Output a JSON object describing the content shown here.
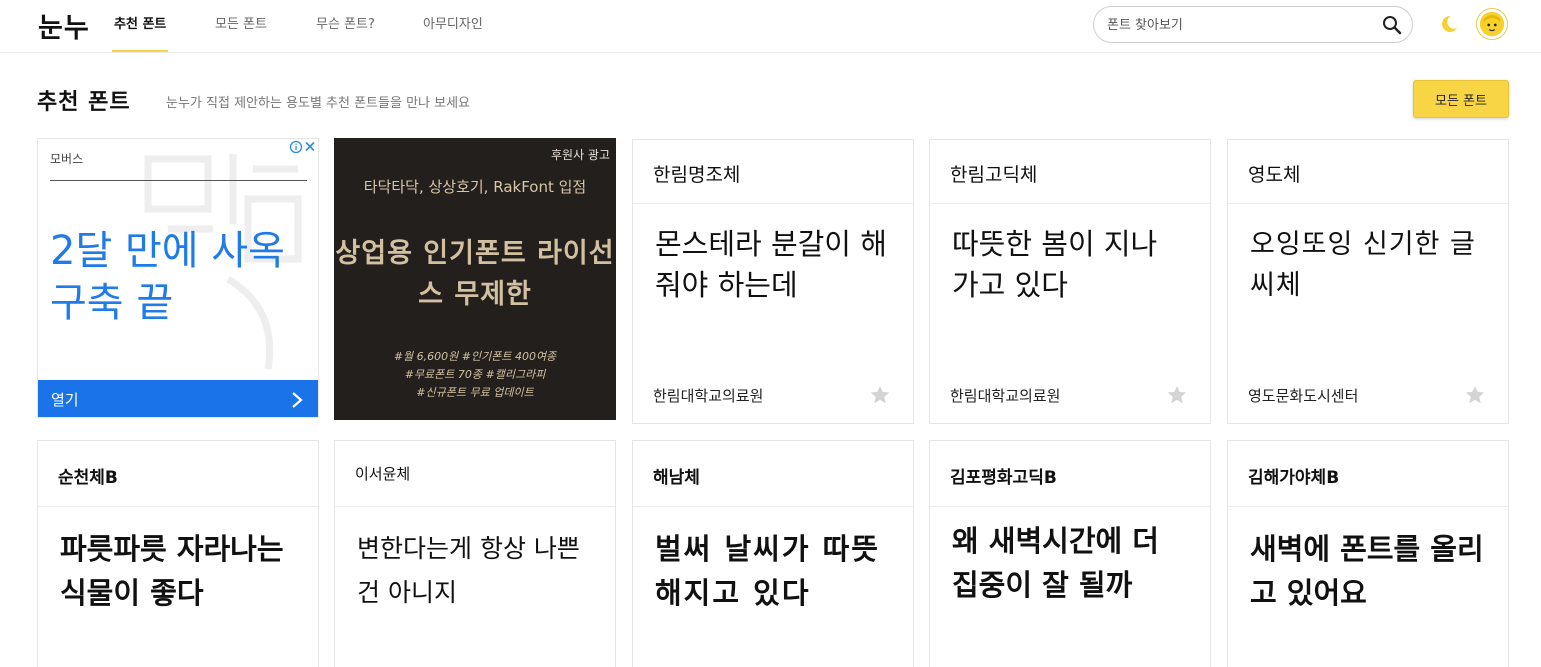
{
  "header": {
    "logo": "눈누",
    "nav": [
      "추천 폰트",
      "모든 폰트",
      "무슨 폰트?",
      "아무디자인"
    ],
    "search_placeholder": "폰트 찾아보기"
  },
  "section": {
    "title": "추천 폰트",
    "subtitle": "눈누가 직접 제안하는 용도별 추천 폰트들을 만나 보세요",
    "all_fonts_button": "모든 폰트"
  },
  "ad_google": {
    "label": "모버스",
    "headline": "2달 만에 사옥 구축 끝",
    "open_label": "열기",
    "accent_color": "#1a73e8"
  },
  "ad_sponsor": {
    "badge": "후원사 광고",
    "top_line": "타닥타닥, 상상호기, RakFont 입점",
    "main": "상업용 인기폰트 라이선스 무제한",
    "tags": [
      "#월 6,600원 #인기폰트 400여종",
      "#무료폰트 70종 #캘리그라피",
      "#신규폰트 무료 업데이트"
    ]
  },
  "fonts_row1": [
    {
      "name": "한림명조체",
      "sample": "몬스테라 분갈이 해줘야 하는데",
      "maker": "한림대학교의료원"
    },
    {
      "name": "한림고딕체",
      "sample": "따뜻한 봄이 지나 가고 있다",
      "maker": "한림대학교의료원"
    },
    {
      "name": "영도체",
      "sample": "오잉또잉 신기한 글씨체",
      "maker": "영도문화도시센터"
    }
  ],
  "fonts_row2": [
    {
      "name": "순천체B",
      "sample": "파릇파릇 자라나는 식물이 좋다"
    },
    {
      "name": "이서윤체",
      "sample": "변한다는게 항상 나쁜 건 아니지"
    },
    {
      "name": "해남체",
      "sample": "벌써 날씨가 따뜻해지고 있다"
    },
    {
      "name": "김포평화고딕B",
      "sample": "왜 새벽시간에 더 집중이 잘 될까"
    },
    {
      "name": "김해가야체B",
      "sample": "새벽에 폰트를 올리고 있어요"
    }
  ],
  "colors": {
    "accent_yellow": "#f8d545",
    "star_gray": "#d4d4d4"
  },
  "icons": {
    "search": "search-icon",
    "moon": "moon-icon",
    "star": "star-icon",
    "chevron": "chevron-right-icon"
  }
}
